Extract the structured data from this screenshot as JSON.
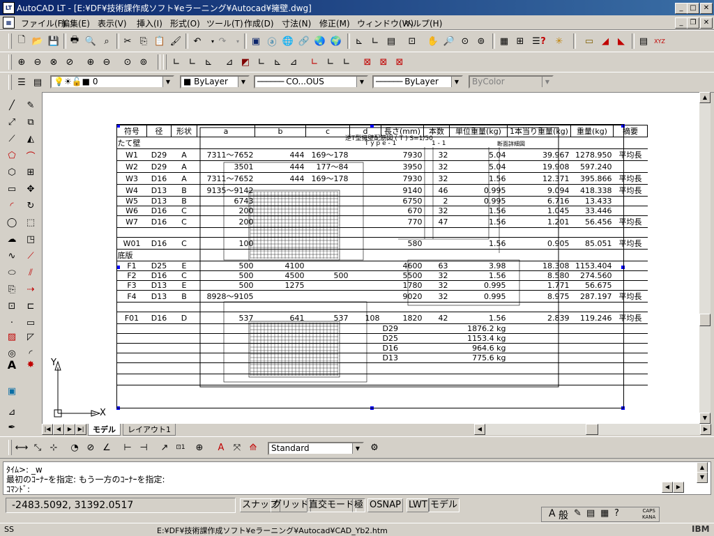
{
  "window": {
    "title": "AutoCAD LT - [E:¥DF¥技術課作成ソフト¥eラーニング¥Autocad¥擁壁.dwg]",
    "app_icon_label": "LT"
  },
  "menu": [
    "ファイル(F)",
    "編集(E)",
    "表示(V)",
    "挿入(I)",
    "形式(O)",
    "ツール(T)",
    "作成(D)",
    "寸法(N)",
    "修正(M)",
    "ウィンドウ(W)",
    "ヘルプ(H)"
  ],
  "layers": {
    "layer_value": "0",
    "color_value": "ByLayer",
    "linetype_value": "CO...OUS",
    "lineweight_value": "ByLayer",
    "plotstyle_value": "ByColor"
  },
  "text_style": "Standard",
  "table": {
    "headers": [
      "符号",
      "径",
      "形状",
      "a",
      "b",
      "c",
      "d",
      "長さ(mm)",
      "本数",
      "単位重量(kg)",
      "1本当り重量(kg)",
      "重量(kg)",
      "摘要"
    ],
    "sections": [
      {
        "title": "たて壁",
        "rows": [
          [
            "W1",
            "D29",
            "A",
            "7311～7652",
            "444",
            "169～178",
            "",
            "7930",
            "32",
            "5.04",
            "39.967",
            "1278.950",
            "平均長"
          ],
          [
            "W2",
            "D29",
            "A",
            "3501",
            "444",
            "177～84",
            "",
            "3950",
            "32",
            "5.04",
            "19.908",
            "597.240",
            ""
          ],
          [
            "W3",
            "D16",
            "A",
            "7311～7652",
            "444",
            "169～178",
            "",
            "7930",
            "32",
            "1.56",
            "12.371",
            "395.866",
            "平均長"
          ],
          [
            "W4",
            "D13",
            "B",
            "9135～9142",
            "",
            "",
            "",
            "9140",
            "46",
            "0.995",
            "9.094",
            "418.338",
            "平均長"
          ],
          [
            "W5",
            "D13",
            "B",
            "6743",
            "",
            "",
            "",
            "6750",
            "2",
            "0.995",
            "6.716",
            "13.433",
            ""
          ],
          [
            "W6",
            "D16",
            "C",
            "200",
            "",
            "",
            "",
            "670",
            "32",
            "1.56",
            "1.045",
            "33.446",
            ""
          ],
          [
            "W7",
            "D16",
            "C",
            "200",
            "",
            "",
            "",
            "770",
            "47",
            "1.56",
            "1.201",
            "56.456",
            "平均長"
          ],
          [
            "",
            "",
            "",
            "",
            "",
            "",
            "",
            "",
            "",
            "",
            "",
            "",
            ""
          ],
          [
            "W01",
            "D16",
            "C",
            "100",
            "",
            "",
            "",
            "580",
            "",
            "1.56",
            "0.905",
            "85.051",
            "平均長"
          ]
        ]
      },
      {
        "title": "底版",
        "rows": [
          [
            "F1",
            "D25",
            "E",
            "500",
            "4100",
            "",
            "",
            "4600",
            "63",
            "3.98",
            "18.308",
            "1153.404",
            ""
          ],
          [
            "F2",
            "D16",
            "C",
            "500",
            "4500",
            "500",
            "",
            "5500",
            "32",
            "1.56",
            "8.580",
            "274.560",
            ""
          ],
          [
            "F3",
            "D13",
            "E",
            "500",
            "1275",
            "",
            "",
            "1780",
            "32",
            "0.995",
            "1.771",
            "56.675",
            ""
          ],
          [
            "F4",
            "D13",
            "B",
            "8928～9105",
            "",
            "",
            "",
            "9020",
            "32",
            "0.995",
            "8.975",
            "287.197",
            "平均長"
          ],
          [
            "",
            "",
            "",
            "",
            "",
            "",
            "",
            "",
            "",
            "",
            "",
            "",
            ""
          ],
          [
            "F01",
            "D16",
            "D",
            "537",
            "641",
            "537",
            "108",
            "1820",
            "42",
            "1.56",
            "2.839",
            "119.246",
            "平均長"
          ]
        ]
      }
    ],
    "totals": [
      {
        "name": "D29",
        "value": "1876.2 kg"
      },
      {
        "name": "D25",
        "value": "1153.4 kg"
      },
      {
        "name": "D16",
        "value": "964.6 kg"
      },
      {
        "name": "D13",
        "value": "775.6 kg"
      }
    ],
    "overlay_title": "逆T型擁壁配筋図 ( T ) S=1/50",
    "overlay_sub1": "T y p e - 1",
    "overlay_sub2": "1 - 1",
    "overlay_sub3": "断面詳細図"
  },
  "ucs": {
    "x_label": "X",
    "y_label": "Y"
  },
  "tabs": [
    "モデル",
    "レイアウト1"
  ],
  "command": {
    "line1": "ﾀｲﾑ>: _w",
    "line2": "最初のｺｰﾅｰを指定: もう一方のｺｰﾅｰを指定:",
    "prompt": "ｺﾏﾝﾄﾞ:"
  },
  "status": {
    "coords": "-2483.5092, 31392.0517",
    "buttons": [
      "スナップ",
      "グリッド",
      "直交モード",
      "極",
      "OSNAP",
      "LWT",
      "モデル"
    ]
  },
  "ime": {
    "mode": "A",
    "kind": "般",
    "caps": "CAPS",
    "kana": "KANA"
  },
  "taskbar": {
    "left": "SS",
    "path": "E:¥DF¥技術課作成ソフト¥eラーニング¥Autocad¥CAD_Yb2.htm",
    "brand": "IBM"
  }
}
